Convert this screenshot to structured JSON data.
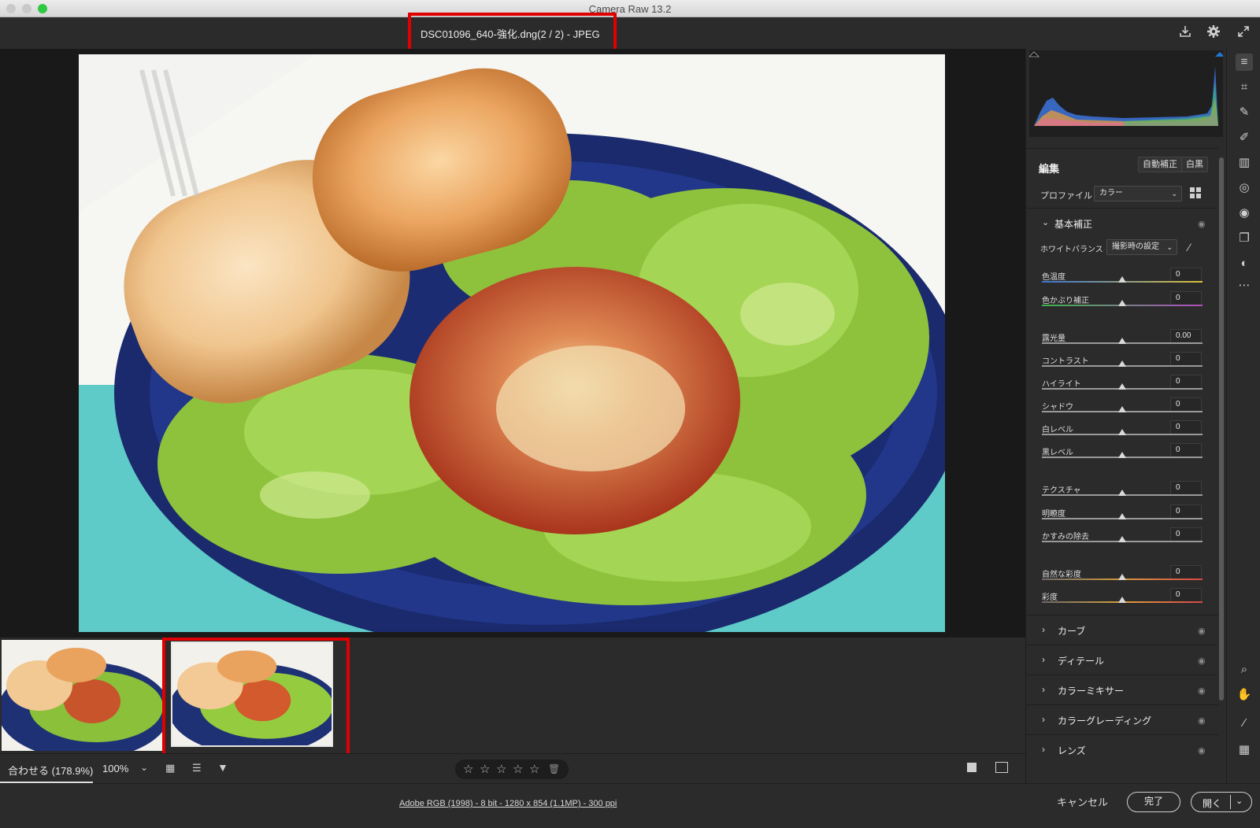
{
  "window": {
    "app_title": "Camera Raw 13.2"
  },
  "topbar": {
    "filename": "DSC01096_640-強化.dng(2 / 2)  -  JPEG"
  },
  "zoom": {
    "fit_label": "合わせる (178.9%)",
    "percent_label": "100%"
  },
  "status": {
    "file_info": "Adobe RGB (1998) - 8 bit - 1280 x 854 (1.1MP) - 300 ppi"
  },
  "buttons": {
    "cancel": "キャンセル",
    "done": "完了",
    "open": "開く"
  },
  "panel": {
    "edit_title": "編集",
    "auto_label": "自動補正",
    "bw_label": "白黒",
    "profile_label": "プロファイル",
    "profile_value": "カラー",
    "basic_section": "基本補正",
    "wb_label": "ホワイトバランス",
    "wb_value": "撮影時の設定",
    "sliders": [
      {
        "label": "色温度",
        "value": "0"
      },
      {
        "label": "色かぶり補正",
        "value": "0"
      },
      {
        "label": "露光量",
        "value": "0.00"
      },
      {
        "label": "コントラスト",
        "value": "0"
      },
      {
        "label": "ハイライト",
        "value": "0"
      },
      {
        "label": "シャドウ",
        "value": "0"
      },
      {
        "label": "白レベル",
        "value": "0"
      },
      {
        "label": "黒レベル",
        "value": "0"
      },
      {
        "label": "テクスチャ",
        "value": "0"
      },
      {
        "label": "明瞭度",
        "value": "0"
      },
      {
        "label": "かすみの除去",
        "value": "0"
      },
      {
        "label": "自然な彩度",
        "value": "0"
      },
      {
        "label": "彩度",
        "value": "0"
      }
    ],
    "collapsed_sections": [
      "カーブ",
      "ディテール",
      "カラーミキサー",
      "カラーグレーディング",
      "レンズ"
    ]
  },
  "icons": {
    "topbar": [
      "download-icon",
      "gear-icon",
      "expand-icon"
    ],
    "tools": [
      "sliders-icon",
      "crop-icon",
      "healing-icon",
      "brush-icon",
      "gradient-icon",
      "radial-icon",
      "redeye-icon",
      "snapshots-icon",
      "presets-icon",
      "more-icon",
      "zoom-icon",
      "hand-icon",
      "color-sampler-icon",
      "grid-icon"
    ]
  },
  "colors": {
    "accent_red": "#e00000",
    "bg": "#2b2b2b",
    "canvas_bg": "#191919"
  }
}
